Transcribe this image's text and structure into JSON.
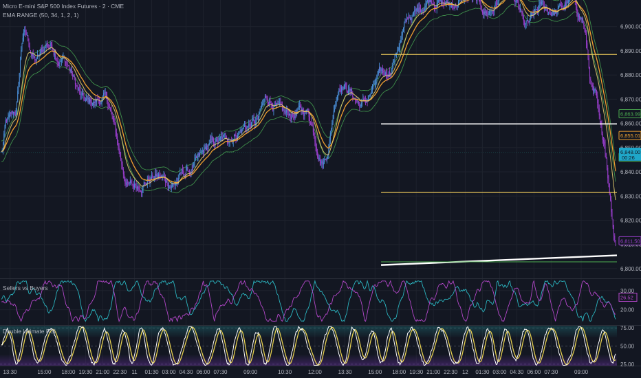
{
  "header": {
    "symbol_title": "Micro E-mini S&P 500 Index Futures · 2 · CME",
    "indicator_label": "EMA RANGE (50, 34, 1, 2, 1)"
  },
  "panes": {
    "price_label": "",
    "osc1_label": "Sellers vs Buyers",
    "osc2_label": "Double Ultimate RSI"
  },
  "colors": {
    "background": "#131722",
    "grid": "#1e222d",
    "candle_blue": "#4a8fd9",
    "candle_purple": "#9c3fd0",
    "ema_fast": "#f0a030",
    "ema_slow": "#e6d070",
    "envelope": "#3f8f4a",
    "level_yellow": "#e6c45a",
    "level_white": "#ffffff",
    "trend_white": "#ffffff",
    "trend_green": "#4caf50",
    "axis_text": "#b2b5be",
    "osc_teal": "#2bb5c0",
    "osc_purple": "#b347c9",
    "rsi_white": "#ffffff",
    "rsi_yellow": "#e6d050",
    "rsi_fill_top": "#1f6f75",
    "rsi_fill_bottom": "#5a2d8a"
  },
  "chart_data": [
    {
      "type": "candlestick",
      "pane": "price",
      "ylim": [
        6796,
        6911
      ],
      "y_ticks": [
        "6,900.00",
        "6,890.00",
        "6,880.00",
        "6,870.00",
        "6,860.00",
        "6,850.00",
        "6,840.00",
        "6,830.00",
        "6,820.00",
        "6,810.00",
        "6,800.00"
      ],
      "y_tick_values": [
        6900,
        6890,
        6880,
        6870,
        6860,
        6850,
        6840,
        6830,
        6820,
        6810,
        6800
      ],
      "x_ticks": [
        "13:30",
        "15:00",
        "18:00",
        "19:30",
        "21:00",
        "22:30",
        "11",
        "01:30",
        "03:00",
        "04:30",
        "06:00",
        "07:30",
        "09:00",
        "10:30",
        "12:00",
        "13:30",
        "15:00",
        "18:00",
        "19:30",
        "21:00",
        "22:30",
        "12",
        "01:30",
        "03:00",
        "04:30",
        "06:00",
        "07:30",
        "09:00"
      ],
      "x_tick_index": [
        10,
        50,
        78,
        98,
        118,
        138,
        155,
        175,
        195,
        215,
        235,
        255,
        290,
        330,
        365,
        400,
        435,
        463,
        483,
        503,
        523,
        540,
        560,
        580,
        600,
        620,
        640,
        675
      ],
      "bar_count": 716,
      "anchors_close": [
        [
          0,
          6848
        ],
        [
          6,
          6860
        ],
        [
          16,
          6864
        ],
        [
          26,
          6897
        ],
        [
          40,
          6886
        ],
        [
          55,
          6893
        ],
        [
          70,
          6887
        ],
        [
          100,
          6868
        ],
        [
          120,
          6870
        ],
        [
          150,
          6834
        ],
        [
          180,
          6838
        ],
        [
          200,
          6835
        ],
        [
          215,
          6840
        ],
        [
          250,
          6852
        ],
        [
          295,
          6860
        ],
        [
          310,
          6870
        ],
        [
          330,
          6863
        ],
        [
          355,
          6865
        ],
        [
          375,
          6845
        ],
        [
          395,
          6877
        ],
        [
          420,
          6868
        ],
        [
          445,
          6880
        ],
        [
          480,
          6905
        ],
        [
          500,
          6912
        ],
        [
          520,
          6909
        ],
        [
          545,
          6912
        ],
        [
          565,
          6906
        ],
        [
          590,
          6915
        ],
        [
          600,
          6908
        ],
        [
          610,
          6900
        ],
        [
          630,
          6908
        ],
        [
          645,
          6906
        ],
        [
          665,
          6911
        ],
        [
          675,
          6904
        ],
        [
          690,
          6872
        ],
        [
          700,
          6853
        ],
        [
          716,
          6812
        ]
      ],
      "last_price": "6,848.00",
      "countdown": "00:26",
      "price_labels": [
        {
          "value": 6863.99,
          "text": "6,863.99",
          "color": "#4caf50"
        },
        {
          "value": 6855.01,
          "text": "6,855.01",
          "color": "#f0a030"
        },
        {
          "value": 6846.03,
          "text": "6,846.03",
          "color": "#4caf50"
        },
        {
          "value": 6811.5,
          "text": "6,811.50",
          "color": "#9c3fd0"
        }
      ],
      "horizontal_levels": [
        {
          "value": 6888.5,
          "from_index": 442,
          "color": "#e6c45a"
        },
        {
          "value": 6859.8,
          "from_index": 442,
          "color": "#ffffff"
        },
        {
          "value": 6831.5,
          "from_index": 442,
          "color": "#e6c45a"
        }
      ],
      "trend_lines": [
        {
          "from": [
            442,
            6801.5
          ],
          "to": [
            740,
            6805.5
          ],
          "color": "#ffffff"
        },
        {
          "from": [
            442,
            6802.8
          ],
          "to": [
            740,
            6802.8
          ],
          "color": "#4caf50"
        }
      ]
    },
    {
      "type": "line",
      "pane": "osc1",
      "ylim": [
        12,
        36
      ],
      "y_ticks": [
        "30.00",
        "20.00"
      ],
      "y_tick_values": [
        30,
        20
      ],
      "last_value_label": "26.52",
      "series_colors": [
        "#2bb5c0",
        "#b347c9"
      ]
    },
    {
      "type": "line",
      "pane": "osc2",
      "ylim": [
        23,
        78
      ],
      "y_ticks": [
        "75.00",
        "50.00",
        "25.00"
      ],
      "y_tick_values": [
        75,
        50,
        25
      ],
      "series_colors": [
        "#ffffff",
        "#e6d050"
      ]
    }
  ]
}
